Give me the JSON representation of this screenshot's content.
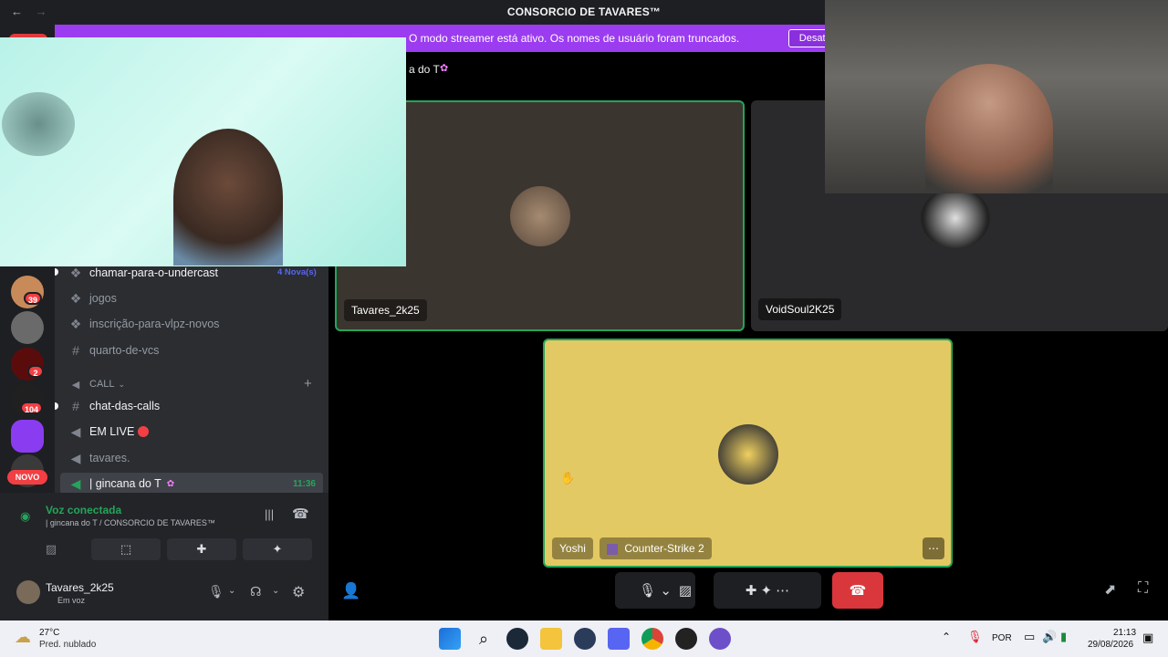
{
  "window": {
    "back_icon": "←",
    "forward_icon": "→",
    "title": "CONSORCIO DE TAVARES™"
  },
  "streamer_banner": {
    "message": "O modo streamer está ativo. Os nomes de usuário foram truncados.",
    "button": "Desativar"
  },
  "header": {
    "channel_name": "a do T"
  },
  "server_badges": [
    "39",
    "2",
    "104"
  ],
  "novo_label": "NOVO",
  "channels": [
    {
      "name": "chamar-para-o-undercast",
      "badge": "4 Nova(s)"
    },
    {
      "name": "jogos"
    },
    {
      "name": "inscrição-para-vlpz-novos"
    },
    {
      "name": "quarto-de-vcs"
    },
    {
      "name": "CALL"
    },
    {
      "name": "chat-das-calls"
    },
    {
      "name": "EM LIVE"
    },
    {
      "name": "tavares."
    },
    {
      "name": "| gincana do T",
      "time": "11:36"
    }
  ],
  "voice_panel": {
    "status": "Voz conectada",
    "location": "| gincana do T  / CONSORCIO DE TAVARES™"
  },
  "user": {
    "name": "Tavares_2k25",
    "status": "Em voz"
  },
  "tiles": [
    {
      "name": "Tavares_2k25"
    },
    {
      "name": "VoidSoul2K25"
    },
    {
      "name": "Yoshi",
      "activity": "Counter-Strike 2"
    }
  ],
  "colors": {
    "accent": "#9b3cf0",
    "speaking": "#23a55a",
    "hangup": "#da373c",
    "yoshi_tile": "#e3c963"
  },
  "taskbar": {
    "weather_temp": "27°C",
    "weather_desc": "Pred. nublado",
    "lang": "POR",
    "time": "21:13",
    "date": "29/08/2026"
  }
}
